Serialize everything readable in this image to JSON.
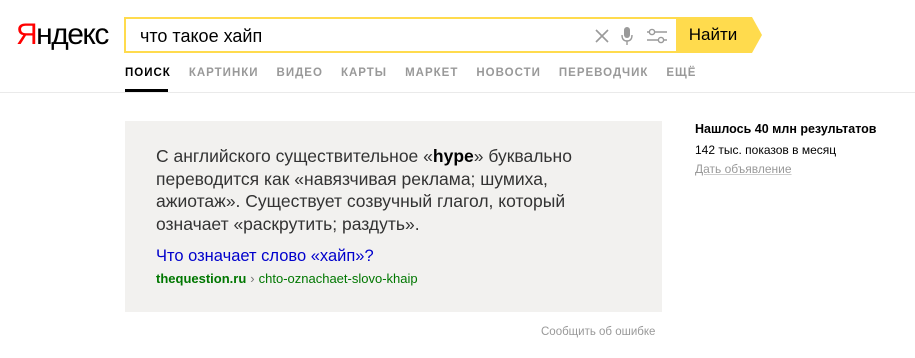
{
  "header": {
    "logo_first": "Я",
    "logo_rest": "ндекс",
    "search_value": "что такое хайп",
    "find_label": "Найти",
    "icons": [
      "close-icon",
      "microphone-icon",
      "filter-icon"
    ]
  },
  "tabs": [
    {
      "label": "Поиск",
      "active": true
    },
    {
      "label": "Картинки",
      "active": false
    },
    {
      "label": "Видео",
      "active": false
    },
    {
      "label": "Карты",
      "active": false
    },
    {
      "label": "Маркет",
      "active": false
    },
    {
      "label": "Новости",
      "active": false
    },
    {
      "label": "Переводчик",
      "active": false
    },
    {
      "label": "Ещё",
      "active": false
    }
  ],
  "answer": {
    "text_before": "С английского существительное «",
    "term": "hype",
    "text_after": "» буквально переводится как «навязчивая реклама; шумиха, ажиотаж». Существует созвучный глагол, который означает «раскрутить; раздуть».",
    "link_title": "Что означает слово «хайп»?",
    "source_domain": "thequestion.ru",
    "source_separator": "›",
    "source_path": "chto-oznachaet-slovo-khaip",
    "report": "Сообщить об ошибке"
  },
  "stats": {
    "found": "Нашлось 40 млн результатов",
    "shows": "142 тыс. показов в месяц",
    "ad": "Дать объявление"
  },
  "colors": {
    "accent": "#ffdb4d",
    "logo_red": "#ff0000",
    "card_bg": "#f2f1ef",
    "link": "#0000cc",
    "source": "#007700"
  }
}
